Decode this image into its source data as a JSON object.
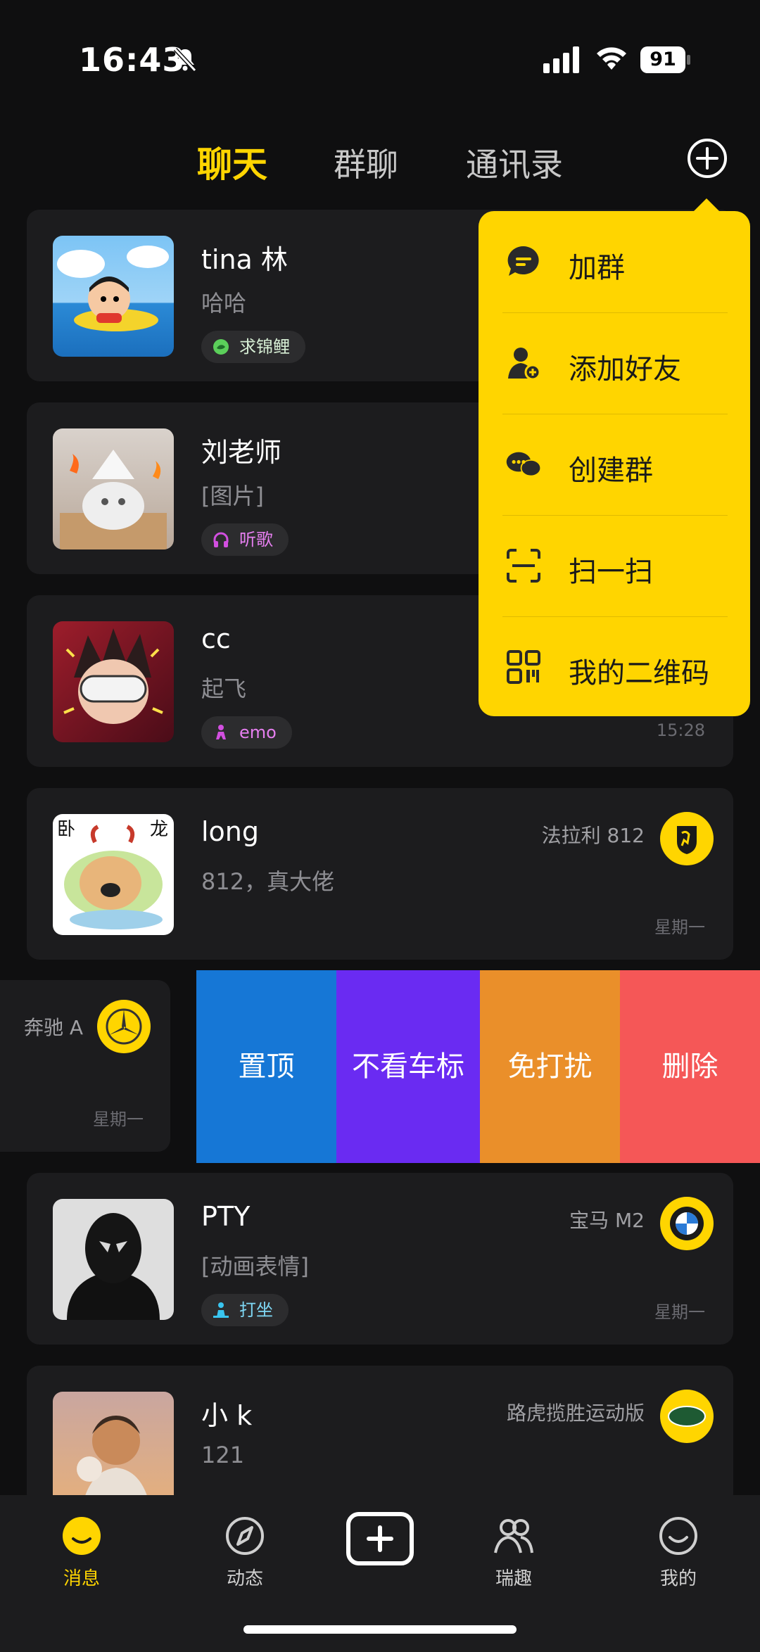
{
  "status": {
    "time": "16:43",
    "battery": "91"
  },
  "tabs": [
    {
      "label": "聊天",
      "active": true
    },
    {
      "label": "群聊",
      "active": false
    },
    {
      "label": "通讯录",
      "active": false
    }
  ],
  "popup": {
    "items": [
      {
        "label": "加群",
        "icon": "chat-bubble-icon"
      },
      {
        "label": "添加好友",
        "icon": "add-friend-icon"
      },
      {
        "label": "创建群",
        "icon": "group-chat-icon"
      },
      {
        "label": "扫一扫",
        "icon": "scan-icon"
      },
      {
        "label": "我的二维码",
        "icon": "qr-code-icon"
      }
    ]
  },
  "chats": [
    {
      "name": "tina 林",
      "message": "哈哈",
      "badge": "求锦鲤",
      "badge_color": "#6ed36b",
      "car": "",
      "time": ""
    },
    {
      "name": "刘老师",
      "message": "[图片]",
      "badge": "听歌",
      "badge_color": "#c74bd1",
      "car": "",
      "time": ""
    },
    {
      "name": "cc",
      "message": "起飞",
      "badge": "emo",
      "badge_color": "#c74bd1",
      "car": "",
      "time": "15:28"
    },
    {
      "name": "long",
      "message": "812，真大佬",
      "badge": "",
      "car": "法拉利 812",
      "time": "星期一"
    },
    {
      "name": "PTY",
      "message": "[动画表情]",
      "badge": "打坐",
      "badge_color": "#39c5f0",
      "car": "宝马 M2",
      "time": "星期一"
    },
    {
      "name": "小 k",
      "message": "121",
      "badge": "",
      "car": "路虎揽胜运动版",
      "time": ""
    }
  ],
  "swiped": {
    "car": "奔驰 A",
    "time": "星期一",
    "actions": [
      {
        "label": "置顶",
        "color": "#1677d6"
      },
      {
        "label": "不看车标",
        "color": "#6a2bf2"
      },
      {
        "label": "免打扰",
        "color": "#ea8f2a"
      },
      {
        "label": "删除",
        "color": "#f55757"
      }
    ]
  },
  "bottom_nav": [
    {
      "label": "消息",
      "active": true
    },
    {
      "label": "动态",
      "active": false
    },
    {
      "label": "瑞趣",
      "active": false
    },
    {
      "label": "我的",
      "active": false
    }
  ],
  "colors": {
    "accent": "#ffd500",
    "background": "#0f0f10",
    "card": "#1c1c1e"
  }
}
